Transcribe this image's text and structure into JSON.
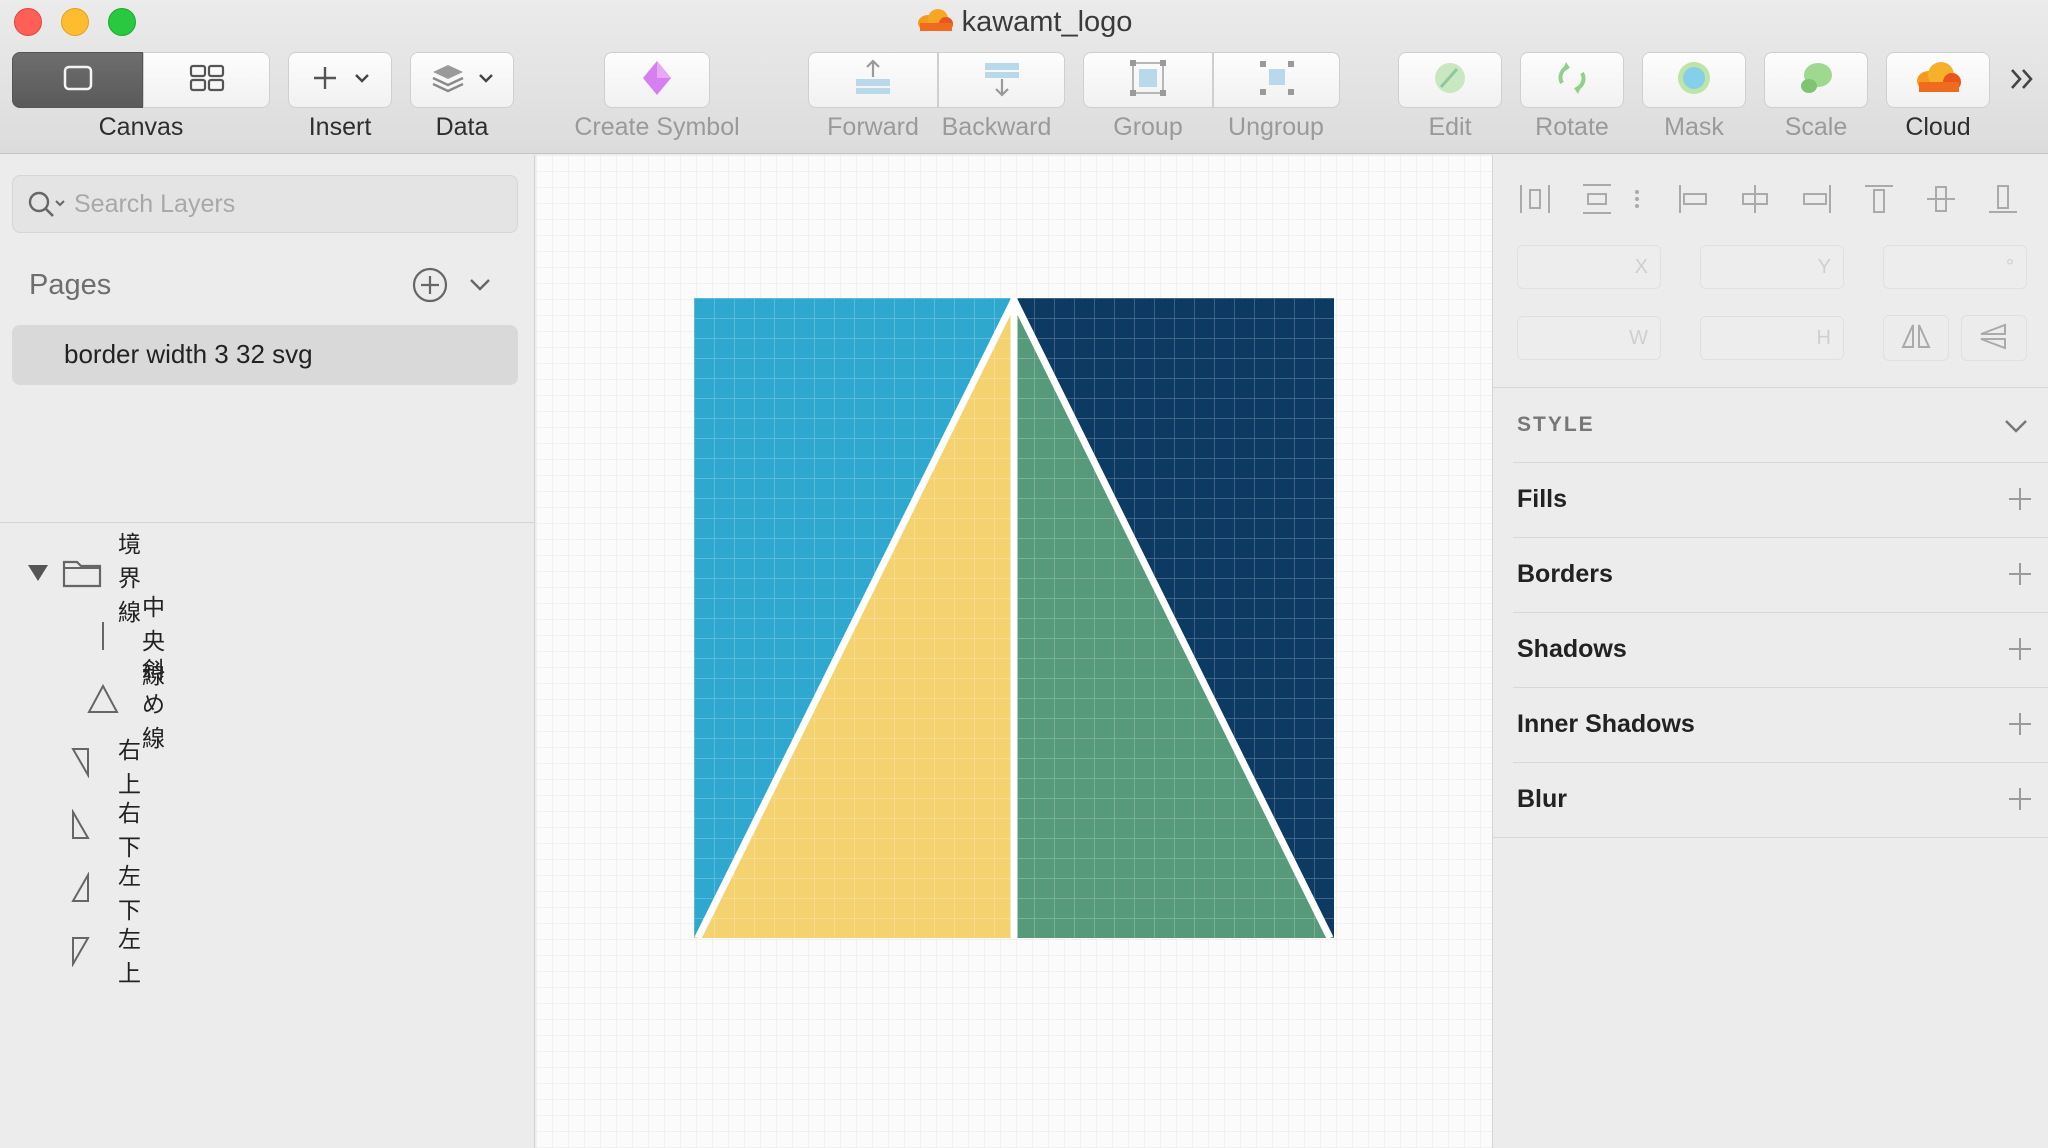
{
  "window": {
    "title": "kawamt_logo"
  },
  "toolbar": {
    "canvas_label": "Canvas",
    "insert_label": "Insert",
    "data_label": "Data",
    "create_symbol_label": "Create Symbol",
    "forward_label": "Forward",
    "backward_label": "Backward",
    "group_label": "Group",
    "ungroup_label": "Ungroup",
    "edit_label": "Edit",
    "rotate_label": "Rotate",
    "mask_label": "Mask",
    "scale_label": "Scale",
    "cloud_label": "Cloud",
    "icons": [
      "canvas-view-icon",
      "grid-view-icon",
      "plus-icon",
      "chevron-down-icon",
      "data-stack-icon",
      "symbol-diamond-icon",
      "forward-icon",
      "backward-icon",
      "group-icon",
      "ungroup-icon",
      "edit-icon",
      "rotate-icon",
      "mask-icon",
      "scale-icon",
      "cloud-icon",
      "more-icon"
    ]
  },
  "sidebar": {
    "search_placeholder": "Search Layers",
    "pages_label": "Pages",
    "pages": [
      {
        "label": "border width 3 32 svg"
      }
    ],
    "layers": [
      {
        "label": "境界線",
        "icon": "folder-icon",
        "expanded": true
      },
      {
        "label": "中央線",
        "icon": "line-icon"
      },
      {
        "label": "斜め線",
        "icon": "triangle-outline-icon"
      },
      {
        "label": "右上",
        "icon": "triangle-right-top-icon"
      },
      {
        "label": "右下",
        "icon": "triangle-right-bottom-icon"
      },
      {
        "label": "左下",
        "icon": "triangle-left-bottom-icon"
      },
      {
        "label": "左上",
        "icon": "triangle-left-top-icon"
      }
    ]
  },
  "inspector": {
    "field_suffixes": {
      "x": "X",
      "y": "Y",
      "rotation": "°",
      "w": "W",
      "h": "H"
    },
    "style_header": "STYLE",
    "sections": [
      "Fills",
      "Borders",
      "Shadows",
      "Inner Shadows",
      "Blur"
    ]
  },
  "artwork": {
    "colors": {
      "top_left": "#2fa8cf",
      "bottom_left": "#f4d26f",
      "bottom_right": "#579a7b",
      "top_right": "#0d3a63",
      "stroke": "#ffffff"
    }
  }
}
